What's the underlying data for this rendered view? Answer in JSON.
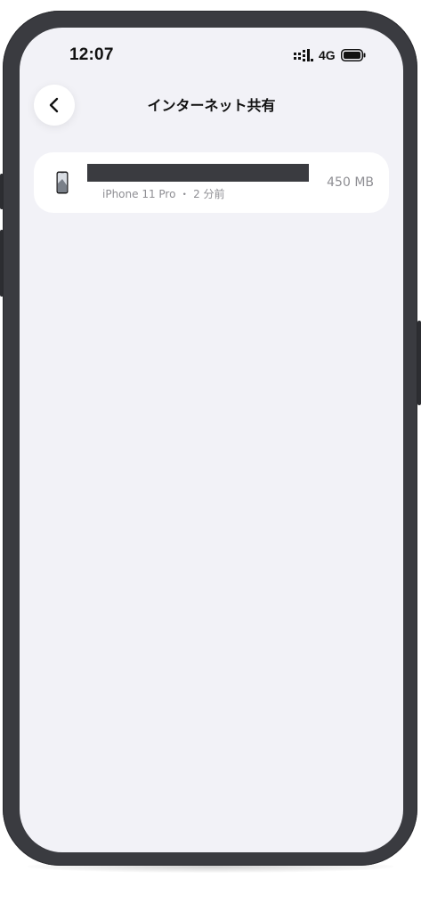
{
  "status_bar": {
    "time": "12:07",
    "network": "4G",
    "signal_icon": "cellular-signal-icon",
    "battery_icon": "battery-icon"
  },
  "nav": {
    "back_icon": "chevron-left-icon",
    "title": "インターネット共有"
  },
  "devices": [
    {
      "name": "",
      "icon": "iphone-icon",
      "meta": "iPhone 11 Pro ・ 2 分前",
      "usage": "450 MB"
    }
  ],
  "colors": {
    "phone_frame": "#3a3b40",
    "screen_background": "#f2f2f7",
    "card_background": "#ffffff",
    "primary_text": "#111111",
    "secondary_text": "#8e8e93",
    "redaction": "#3a3b40"
  }
}
